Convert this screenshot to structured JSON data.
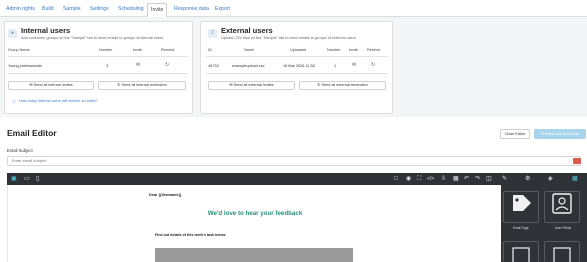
{
  "tabs": [
    {
      "label": "Admin rights"
    },
    {
      "label": "Build"
    },
    {
      "label": "Sample"
    },
    {
      "label": "Settings"
    },
    {
      "label": "Scheduling"
    },
    {
      "label": "Invite",
      "active": true
    },
    {
      "label": "Response data"
    },
    {
      "label": "Export"
    }
  ],
  "internal": {
    "title": "Internal users",
    "subtitle": "Add consumer groups on the \"Sample\" tab to send emails to groups of internal users",
    "headers": {
      "group": "Group Name",
      "number": "Number",
      "invite": "Invite",
      "remind": "Remind"
    },
    "row": {
      "group": "Young professionals",
      "number": "3"
    },
    "send_invites": "Send all internal invites",
    "send_reminders": "Send all internal reminders",
    "help_link": "How many internal users will receive an invite?"
  },
  "external": {
    "title": "External users",
    "subtitle": "Upload CSV files on the \"Sample\" tab to send emails to groups of external users",
    "headers": {
      "id": "ID",
      "name": "Name",
      "uploaded": "Uploaded",
      "number": "Number",
      "invite": "Invite",
      "remind": "Remind"
    },
    "row": {
      "id": "46733",
      "name": "exampleupload.csv",
      "uploaded": "18 Mar 2026 11:38",
      "number": "1"
    },
    "send_invites": "Send all external invites",
    "send_reminders": "Send all external reminders"
  },
  "editor": {
    "title": "Email Editor",
    "close": "Close Editor",
    "preview": "Preview and test email",
    "subject_label": "Email Subject",
    "subject_placeholder": "Enter email subject",
    "greeting": "Dear {{firstname}}",
    "headline": "We'd love to hear your feedback",
    "subline": "Find out details of this week's task below."
  },
  "blocks": [
    {
      "label": "Email Tags"
    },
    {
      "label": "User Fields"
    }
  ],
  "colors": {
    "accent": "#3a7bc8",
    "headline": "#2a8f7a",
    "toolbar": "#2f3338",
    "preview_button": "#a9d5ec"
  }
}
